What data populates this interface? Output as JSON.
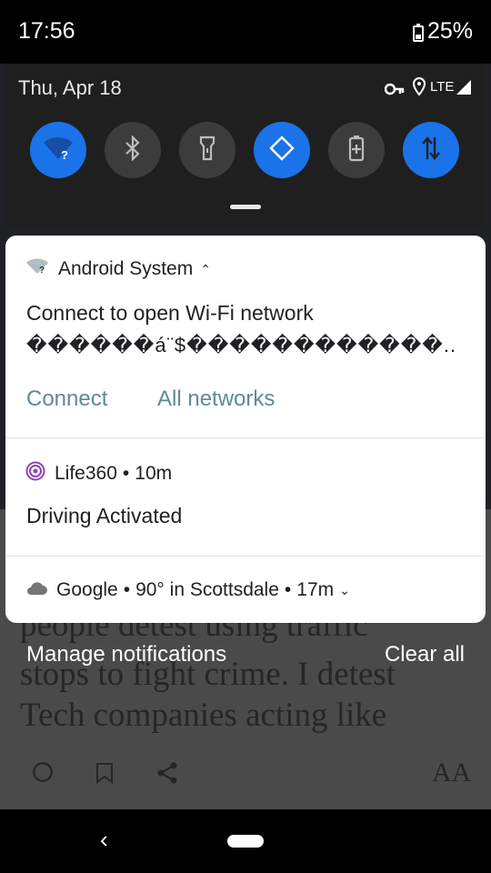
{
  "status_bar": {
    "time": "17:56",
    "battery": "25%"
  },
  "quick_settings": {
    "date": "Thu, Apr 18",
    "network": "LTE",
    "tiles": [
      {
        "icon": "wifi-icon",
        "state": "on"
      },
      {
        "icon": "bluetooth-icon",
        "state": "off"
      },
      {
        "icon": "flashlight-icon",
        "state": "off"
      },
      {
        "icon": "auto-rotate-icon",
        "state": "on"
      },
      {
        "icon": "battery-saver-icon",
        "state": "off"
      },
      {
        "icon": "mobile-data-icon",
        "state": "on"
      }
    ]
  },
  "notifications": {
    "wifi": {
      "app": "Android System",
      "title": "Connect to open Wi-Fi network",
      "text": "������á¨$������������..",
      "actions": {
        "connect": "Connect",
        "all_networks": "All networks"
      }
    },
    "life360": {
      "app": "Life360",
      "time": "10m",
      "title": "Driving Activated"
    },
    "google": {
      "app": "Google",
      "detail": "90° in Scottsdale",
      "time": "17m"
    }
  },
  "footer": {
    "manage": "Manage notifications",
    "clear": "Clear all"
  },
  "background_article": {
    "lines": [
      "people detest using traffic",
      "stops to fight crime. I detest",
      "Tech companies acting like"
    ],
    "font_button": "AA"
  },
  "colors": {
    "accent": "#1a73e8",
    "action": "#5f8a96",
    "life360": "#8e44ad"
  }
}
